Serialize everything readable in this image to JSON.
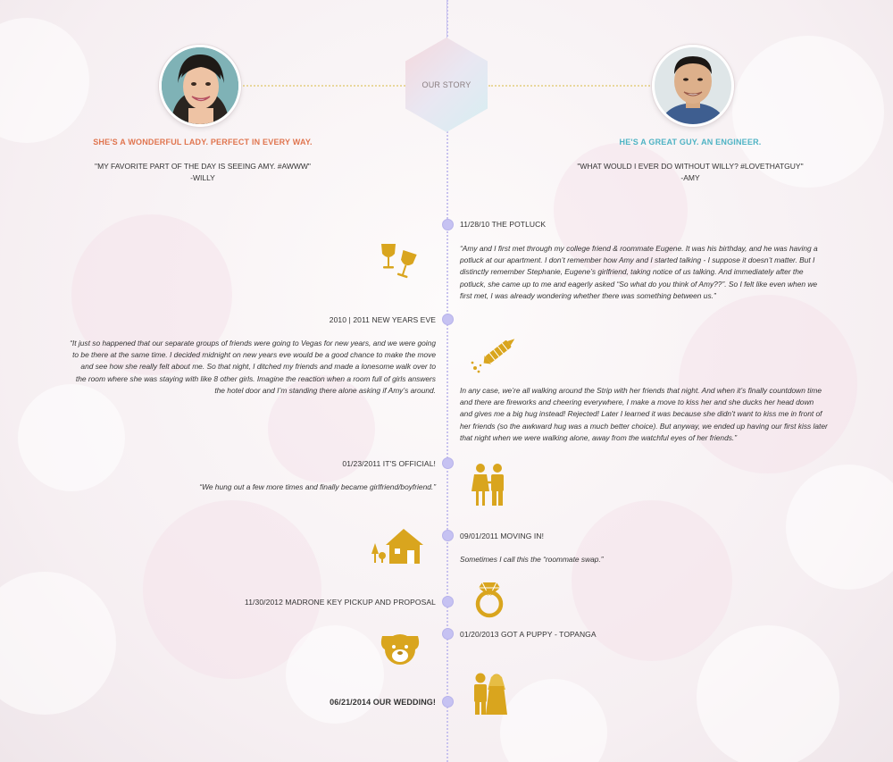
{
  "header": {
    "title": "OUR STORY",
    "left_person": {
      "tagline": "SHE'S A WONDERFUL LADY. PERFECT IN EVERY WAY.",
      "quote": "\"MY FAVORITE PART OF THE DAY IS SEEING AMY. #AWWW\"",
      "attribution": "-WILLY"
    },
    "right_person": {
      "tagline": "HE'S A GREAT GUY. AN ENGINEER.",
      "quote": "\"WHAT WOULD I EVER DO WITHOUT WILLY? #LOVETHATGUY\"",
      "attribution": "-AMY"
    }
  },
  "colors": {
    "left_accent": "#e0754f",
    "right_accent": "#4fb3c4",
    "gold": "#d9a51e",
    "timeline": "#c6c2f2"
  },
  "events": [
    {
      "title": "11/28/10 THE POTLUCK",
      "text": "“Amy and I first met through my college friend & roommate Eugene. It was his birthday, and he was having a potluck at our apartment. I don’t remember how Amy and I started talking - I suppose it doesn’t matter. But I distinctly remember Stephanie, Eugene’s girlfriend, taking notice of us talking.  And immediately after the potluck, she came up to me and eagerly asked “So what do you think of Amy??”. So I felt like even when we first met, I was already wondering whether there was something between us.”",
      "icon": "wine-glasses-icon"
    },
    {
      "title": "2010 | 2011 NEW YEARS EVE",
      "text": "“It just so happened that our separate groups of friends were going to Vegas for new years, and we were going to be there at the same time. I decided midnight on new years eve would be a good chance to make the move and see how she really felt about me. So that night, I ditched my friends and made a lonesome walk over to the room where she was staying with like 8 other girls. Imagine the reaction when a room full of girls answers the hotel door and I’m standing there alone asking if Amy’s around.",
      "text2": "In any case, we’re all walking around the Strip with her friends that night. And when it’s finally countdown time and there are fireworks and cheering everywhere, I make a move to kiss her and she ducks her head down and gives me a big hug instead! Rejected! Later I learned it was because she didn’t want to kiss me in front of her friends (so the awkward hug was a much better choice). But anyway, we ended up having our first kiss later that night when we were walking alone, away from the watchful eyes of her friends.”",
      "icon": "firework-icon"
    },
    {
      "title": "01/23/2011 IT'S OFFICIAL!",
      "text": "“We hung out a few more times and finally became girlfriend/boyfriend.”",
      "icon": "couple-icon"
    },
    {
      "title": "09/01/2011 MOVING IN!",
      "text": "Sometimes I call this the “roommate swap.”",
      "icon": "house-icon"
    },
    {
      "title": "11/30/2012 MADRONE KEY PICKUP AND PROPOSAL",
      "icon": "ring-icon"
    },
    {
      "title": "01/20/2013 GOT A PUPPY - TOPANGA",
      "icon": "puppy-icon"
    },
    {
      "title": "06/21/2014 OUR WEDDING!",
      "icon": "wedding-couple-icon"
    }
  ]
}
